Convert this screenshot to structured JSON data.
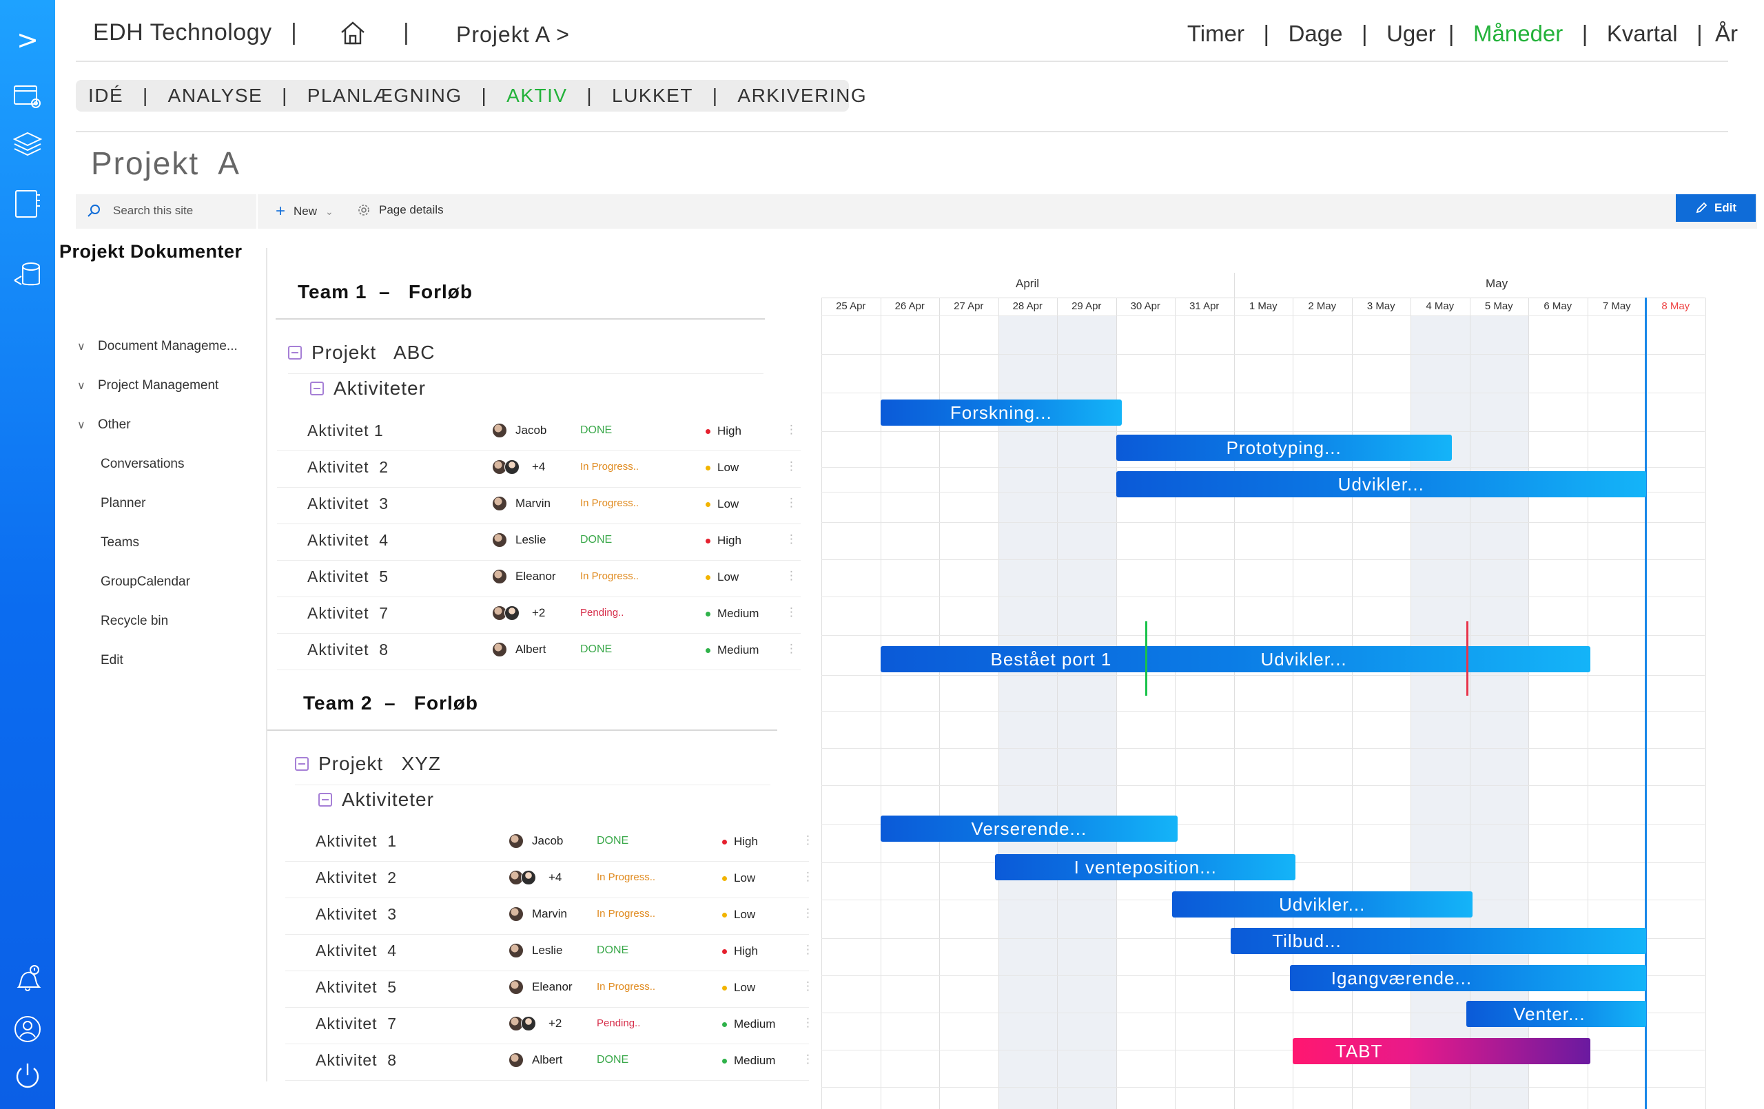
{
  "sidebar": {
    "items": [
      {
        "icon": "chevron-right-icon",
        "label": ">"
      },
      {
        "icon": "calendar-settings-icon"
      },
      {
        "icon": "layers-icon"
      },
      {
        "icon": "notebook-icon"
      },
      {
        "icon": "database-share-icon"
      },
      {
        "icon": "bell-alert-icon"
      },
      {
        "icon": "user-icon"
      },
      {
        "icon": "power-icon"
      }
    ]
  },
  "header": {
    "brand": "EDH Technology",
    "separator": "|",
    "breadcrumb": "Projekt  A >",
    "timescale": [
      {
        "label": "Timer",
        "active": false
      },
      {
        "label": "Dage",
        "active": false
      },
      {
        "label": "Uger",
        "active": false
      },
      {
        "label": "Måneder",
        "active": true
      },
      {
        "label": "Kvartal",
        "active": false
      },
      {
        "label": "År",
        "active": false
      }
    ],
    "active_color": "#23b23a"
  },
  "stages": [
    {
      "label": "IDÉ",
      "active": false
    },
    {
      "label": "ANALYSE",
      "active": false
    },
    {
      "label": "PLANLÆGNING",
      "active": false
    },
    {
      "label": "AKTIV",
      "active": true
    },
    {
      "label": "LUKKET",
      "active": false
    },
    {
      "label": "ARKIVERING",
      "active": false
    }
  ],
  "page_title": "Projekt  A",
  "commandbar": {
    "search_placeholder": "Search this site",
    "new_label": "New",
    "page_details_label": "Page details",
    "edit_label": "Edit"
  },
  "doc_nav": {
    "title": "Projekt Dokumenter",
    "items": [
      {
        "label": "Document Manageme...",
        "expandable": true
      },
      {
        "label": "Project Management",
        "expandable": true
      },
      {
        "label": "Other",
        "expandable": true
      },
      {
        "label": "Conversations",
        "expandable": false
      },
      {
        "label": "Planner",
        "expandable": false
      },
      {
        "label": "Teams",
        "expandable": false
      },
      {
        "label": "GroupCalendar",
        "expandable": false
      },
      {
        "label": "Recycle bin",
        "expandable": false
      },
      {
        "label": "Edit",
        "expandable": false
      }
    ]
  },
  "teams": [
    {
      "title": "Team 1  –   Forløb",
      "project": "Projekt   ABC",
      "group": "Aktiviteter",
      "activities": [
        {
          "name": "Aktivitet 1",
          "people": [
            "Jacob"
          ],
          "extra": "",
          "status": "DONE",
          "priority": "High"
        },
        {
          "name": "Aktivitet  2",
          "people": [
            "",
            ""
          ],
          "extra": "+4",
          "status": "In Progress..",
          "priority": "Low"
        },
        {
          "name": "Aktivitet  3",
          "people": [
            "Marvin"
          ],
          "extra": "",
          "status": "In Progress..",
          "priority": "Low"
        },
        {
          "name": "Aktivitet  4",
          "people": [
            "Leslie"
          ],
          "extra": "",
          "status": "DONE",
          "priority": "High"
        },
        {
          "name": "Aktivitet  5",
          "people": [
            "Eleanor"
          ],
          "extra": "",
          "status": "In Progress..",
          "priority": "Low"
        },
        {
          "name": "Aktivitet  7",
          "people": [
            "",
            ""
          ],
          "extra": "+2",
          "status": "Pending..",
          "priority": "Medium"
        },
        {
          "name": "Aktivitet  8",
          "people": [
            "Albert"
          ],
          "extra": "",
          "status": "DONE",
          "priority": "Medium"
        }
      ]
    },
    {
      "title": "Team 2  –   Forløb",
      "project": "Projekt   XYZ",
      "group": "Aktiviteter",
      "activities": [
        {
          "name": "Aktivitet  1",
          "people": [
            "Jacob"
          ],
          "extra": "",
          "status": "DONE",
          "priority": "High"
        },
        {
          "name": "Aktivitet  2",
          "people": [
            "",
            ""
          ],
          "extra": "+4",
          "status": "In Progress..",
          "priority": "Low"
        },
        {
          "name": "Aktivitet  3",
          "people": [
            "Marvin"
          ],
          "extra": "",
          "status": "In Progress..",
          "priority": "Low"
        },
        {
          "name": "Aktivitet  4",
          "people": [
            "Leslie"
          ],
          "extra": "",
          "status": "DONE",
          "priority": "High"
        },
        {
          "name": "Aktivitet  5",
          "people": [
            "Eleanor"
          ],
          "extra": "",
          "status": "In Progress..",
          "priority": "Low"
        },
        {
          "name": "Aktivitet  7",
          "people": [
            "",
            ""
          ],
          "extra": "+2",
          "status": "Pending..",
          "priority": "Medium"
        },
        {
          "name": "Aktivitet  8",
          "people": [
            "Albert"
          ],
          "extra": "",
          "status": "DONE",
          "priority": "Medium"
        }
      ]
    }
  ],
  "priority_colors": {
    "High": "#e5202e",
    "Low": "#f2b400",
    "Medium": "#2fb24a"
  },
  "gantt": {
    "months": [
      "April",
      "May"
    ],
    "days": [
      "25 Apr",
      "26 Apr",
      "27 Apr",
      "28 Apr",
      "29 Apr",
      "30 Apr",
      "31 Apr",
      "1 May",
      "2 May",
      "3 May",
      "4 May",
      "5 May",
      "6 May",
      "7 May",
      "8 May"
    ],
    "today": "8 May",
    "shaded_days": [
      "28 Apr",
      "29 Apr",
      "4 May",
      "5 May"
    ],
    "bars": [
      {
        "label": "Forskning...",
        "start": 1,
        "end": 5.1,
        "row": 0,
        "style": "blue"
      },
      {
        "label": "Prototyping...",
        "start": 5.0,
        "end": 10.7,
        "row": 1,
        "style": "blue"
      },
      {
        "label": "Udvikler...",
        "start": 5.0,
        "end": 14.0,
        "row": 2,
        "style": "blue"
      },
      {
        "label": "Bestået port 1",
        "label2": "Udvikler...",
        "start": 1,
        "end": 13.05,
        "row": 3,
        "style": "blue"
      },
      {
        "label": "Verserende...",
        "start": 1,
        "end": 6.05,
        "row": 4,
        "style": "blue"
      },
      {
        "label": "I venteposition...",
        "start": 2.95,
        "end": 8.05,
        "row": 5,
        "style": "blue"
      },
      {
        "label": "Udvikler...",
        "start": 5.95,
        "end": 11.05,
        "row": 6,
        "style": "blue"
      },
      {
        "label": "Tilbud...",
        "start": 6.95,
        "end": 14.0,
        "row": 7,
        "style": "blue"
      },
      {
        "label": "Igangværende...",
        "start": 7.95,
        "end": 14.0,
        "row": 8,
        "style": "blue"
      },
      {
        "label": "Venter...",
        "start": 10.95,
        "end": 14.0,
        "row": 9,
        "style": "blue"
      },
      {
        "label": "TABT",
        "start": 8.0,
        "end": 13.05,
        "row": 10,
        "style": "tabt"
      }
    ],
    "markers": [
      {
        "at": 5.5,
        "color": "#19c24a"
      },
      {
        "at": 10.95,
        "color": "#e8334a"
      }
    ]
  }
}
